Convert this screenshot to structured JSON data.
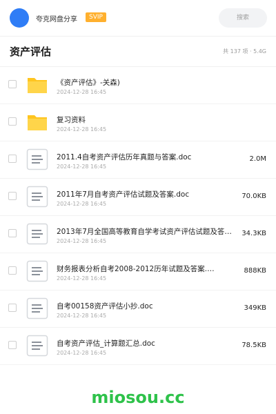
{
  "header": {
    "share_name": "夸克网盘分享",
    "badge": "SVIP",
    "search_placeholder": "搜索"
  },
  "folder": {
    "title": "资产评估",
    "summary": "共 137 项 · 5.4G"
  },
  "files": [
    {
      "type": "folder",
      "name": "《资产评估》-关森)",
      "date": "2024-12-28 16:45",
      "size": ""
    },
    {
      "type": "folder",
      "name": "复习资料",
      "date": "2024-12-28 16:45",
      "size": ""
    },
    {
      "type": "doc",
      "name": "2011.4自考资产评估历年真题与答案.doc",
      "date": "2024-12-28 16:45",
      "size": "2.0M"
    },
    {
      "type": "doc",
      "name": "2011年7月自考资产评估试题及答案.doc",
      "date": "2024-12-28 16:45",
      "size": "70.0KB"
    },
    {
      "type": "doc",
      "name": "2013年7月全国高等教育自学考试资产评估试题及答…",
      "date": "2024-12-28 16:45",
      "size": "34.3KB"
    },
    {
      "type": "doc",
      "name": "财务报表分析自考2008-2012历年试题及答案.…",
      "date": "2024-12-28 16:45",
      "size": "888KB"
    },
    {
      "type": "doc",
      "name": "自考00158资产评估小抄.doc",
      "date": "2024-12-28 16:45",
      "size": "349KB"
    },
    {
      "type": "doc",
      "name": "自考资产评估_计算题汇总.doc",
      "date": "2024-12-28 16:45",
      "size": "78.5KB"
    }
  ],
  "watermark": "miosou.cc",
  "colors": {
    "accent": "#2f7df6",
    "svip": "#ffb02e",
    "folder": "#ffc51f",
    "watermark": "#2ec24a"
  }
}
